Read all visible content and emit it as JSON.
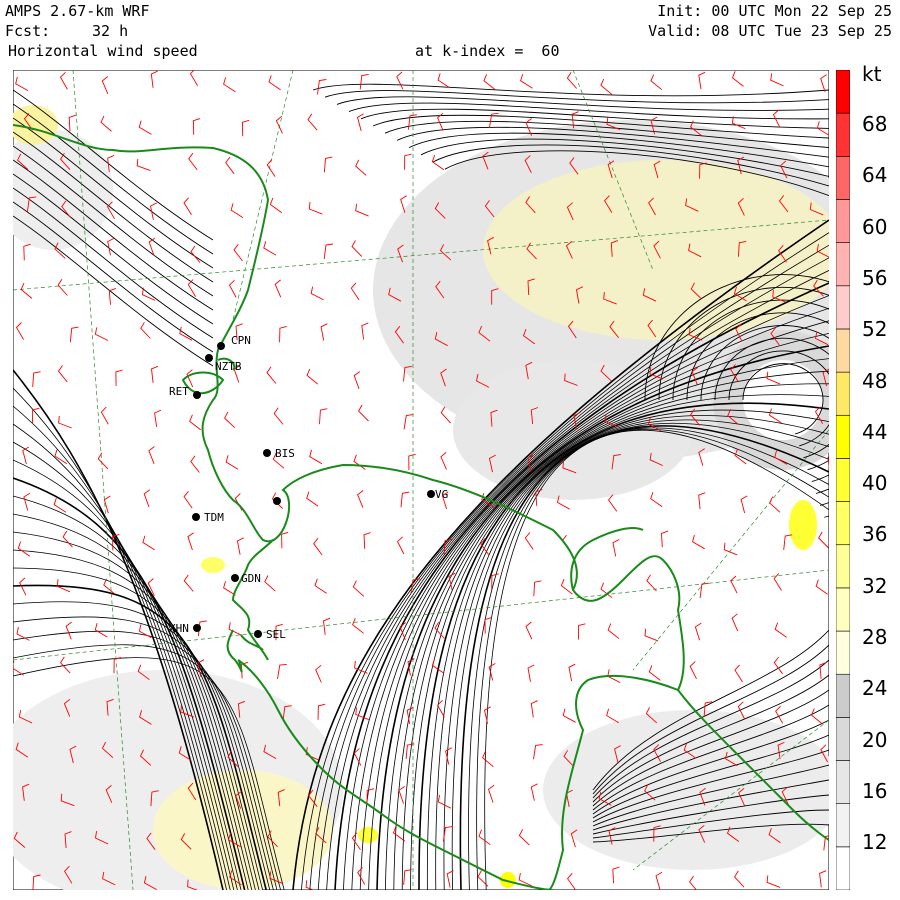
{
  "header": {
    "model": "AMPS 2.67-km WRF",
    "fcst_label": "Fcst:",
    "fcst_value": "32 h",
    "field": "Horizontal wind speed",
    "level": "at k-index =  60",
    "init": "Init: 00 UTC Mon 22 Sep 25",
    "valid": "Valid: 08 UTC Tue 23 Sep 25"
  },
  "colorbar": {
    "unit": "kt",
    "labels": [
      "68",
      "64",
      "60",
      "56",
      "52",
      "48",
      "44",
      "40",
      "36",
      "32",
      "28",
      "24",
      "20",
      "16",
      "12"
    ],
    "colors": [
      "#ffffff",
      "#f2f2f2",
      "#e6e6e6",
      "#d9d9d9",
      "#cccccc",
      "#ffffe0",
      "#ffffc0",
      "#ffff99",
      "#ffff66",
      "#ffff33",
      "#ffff00",
      "#ffe866",
      "#ffd9a0",
      "#ffcccc",
      "#ffb3b3",
      "#ff9999",
      "#ff6666",
      "#ff3333",
      "#ff0000"
    ]
  },
  "stations": [
    {
      "code": "CPN"
    },
    {
      "code": "NZTB"
    },
    {
      "code": "RET"
    },
    {
      "code": "BIS"
    },
    {
      "code": "VG"
    },
    {
      "code": "TDM"
    },
    {
      "code": "GDN"
    },
    {
      "code": "XHN"
    },
    {
      "code": "SEL"
    }
  ],
  "colors": {
    "coast": "#1a8a1a",
    "barb": "#ff0000",
    "streamline": "#000000",
    "grid": "#2a8a2a"
  }
}
